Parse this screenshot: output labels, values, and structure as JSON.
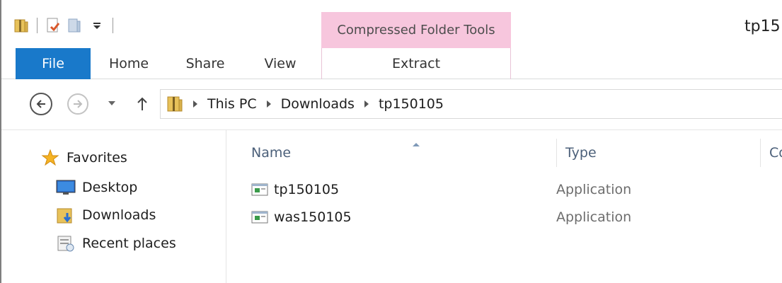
{
  "window": {
    "title": "tp15",
    "contextual_tab": "Compressed Folder Tools"
  },
  "quick_access": [
    "folder-icon",
    "properties-icon",
    "new-folder-icon",
    "customize-dropdown-icon"
  ],
  "ribbon": {
    "tabs": [
      {
        "label": "File",
        "active": true,
        "color": "#1979ca"
      },
      {
        "label": "Home"
      },
      {
        "label": "Share"
      },
      {
        "label": "View"
      },
      {
        "label": "Extract",
        "contextual": true
      }
    ],
    "contextual_color": "#f7c6dd"
  },
  "address": {
    "breadcrumb": [
      "This PC",
      "Downloads",
      "tp150105"
    ]
  },
  "nav_pane": {
    "favorites": {
      "label": "Favorites",
      "icon": "star-icon"
    },
    "items": [
      {
        "label": "Desktop",
        "icon": "desktop-icon"
      },
      {
        "label": "Downloads",
        "icon": "downloads-folder-icon"
      },
      {
        "label": "Recent places",
        "icon": "recent-places-icon"
      }
    ]
  },
  "file_list": {
    "columns": [
      "Name",
      "Type",
      "Co"
    ],
    "sort_column": "Name",
    "rows": [
      {
        "name": "tp150105",
        "type": "Application",
        "icon": "application-icon"
      },
      {
        "name": "was150105",
        "type": "Application",
        "icon": "application-icon"
      }
    ]
  }
}
